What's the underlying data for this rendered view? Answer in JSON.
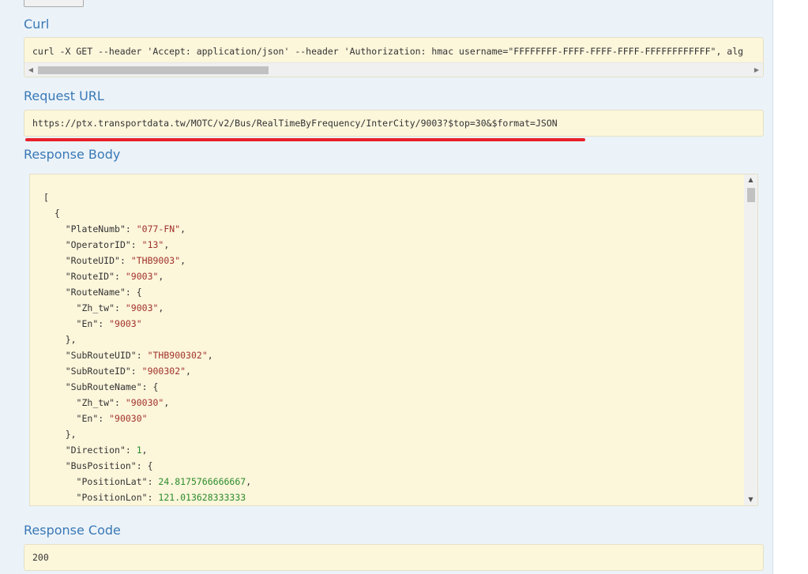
{
  "curl": {
    "title": "Curl",
    "command": "curl -X GET --header 'Accept: application/json' --header 'Authorization: hmac username=\"FFFFFFFF-FFFF-FFFF-FFFF-FFFFFFFFFFFF\", alg"
  },
  "request_url": {
    "title": "Request URL",
    "url": "https://ptx.transportdata.tw/MOTC/v2/Bus/RealTimeByFrequency/InterCity/9003?$top=30&$format=JSON"
  },
  "response_body": {
    "title": "Response Body",
    "lines": [
      {
        "indent": 0,
        "text": "["
      },
      {
        "indent": 1,
        "text": "{"
      },
      {
        "indent": 2,
        "key": "\"PlateNumb\"",
        "value": "\"077-FN\"",
        "vtype": "s",
        "tail": ","
      },
      {
        "indent": 2,
        "key": "\"OperatorID\"",
        "value": "\"13\"",
        "vtype": "s",
        "tail": ","
      },
      {
        "indent": 2,
        "key": "\"RouteUID\"",
        "value": "\"THB9003\"",
        "vtype": "s",
        "tail": ","
      },
      {
        "indent": 2,
        "key": "\"RouteID\"",
        "value": "\"9003\"",
        "vtype": "s",
        "tail": ","
      },
      {
        "indent": 2,
        "key": "\"RouteName\"",
        "value": "{",
        "vtype": "p",
        "tail": ""
      },
      {
        "indent": 3,
        "key": "\"Zh_tw\"",
        "value": "\"9003\"",
        "vtype": "s",
        "tail": ","
      },
      {
        "indent": 3,
        "key": "\"En\"",
        "value": "\"9003\"",
        "vtype": "s",
        "tail": ""
      },
      {
        "indent": 2,
        "text": "},"
      },
      {
        "indent": 2,
        "key": "\"SubRouteUID\"",
        "value": "\"THB900302\"",
        "vtype": "s",
        "tail": ","
      },
      {
        "indent": 2,
        "key": "\"SubRouteID\"",
        "value": "\"900302\"",
        "vtype": "s",
        "tail": ","
      },
      {
        "indent": 2,
        "key": "\"SubRouteName\"",
        "value": "{",
        "vtype": "p",
        "tail": ""
      },
      {
        "indent": 3,
        "key": "\"Zh_tw\"",
        "value": "\"90030\"",
        "vtype": "s",
        "tail": ","
      },
      {
        "indent": 3,
        "key": "\"En\"",
        "value": "\"90030\"",
        "vtype": "s",
        "tail": ""
      },
      {
        "indent": 2,
        "text": "},"
      },
      {
        "indent": 2,
        "key": "\"Direction\"",
        "value": "1",
        "vtype": "n",
        "tail": ","
      },
      {
        "indent": 2,
        "key": "\"BusPosition\"",
        "value": "{",
        "vtype": "p",
        "tail": ""
      },
      {
        "indent": 3,
        "key": "\"PositionLat\"",
        "value": "24.8175766666667",
        "vtype": "n",
        "tail": ","
      },
      {
        "indent": 3,
        "key": "\"PositionLon\"",
        "value": "121.013628333333",
        "vtype": "n",
        "tail": ""
      }
    ]
  },
  "response_code": {
    "title": "Response Code",
    "code": "200"
  }
}
